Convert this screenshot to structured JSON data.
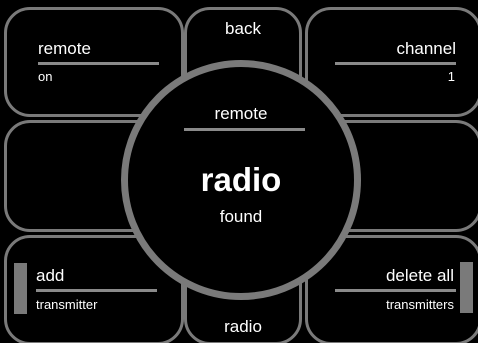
{
  "top_left": {
    "title": "remote",
    "value": "on"
  },
  "top_middle": {
    "label": "back"
  },
  "top_right": {
    "title": "channel",
    "value": "1"
  },
  "bottom_left": {
    "title": "add",
    "value": "transmitter"
  },
  "bottom_middle": {
    "label": "radio"
  },
  "bottom_right": {
    "title": "delete all",
    "value": "transmitters"
  },
  "center_status": {
    "header": "remote",
    "title": "radio",
    "subtitle": "found"
  },
  "colors": {
    "background": "#000000",
    "border": "#7a7a7a",
    "text": "#ffffff"
  }
}
